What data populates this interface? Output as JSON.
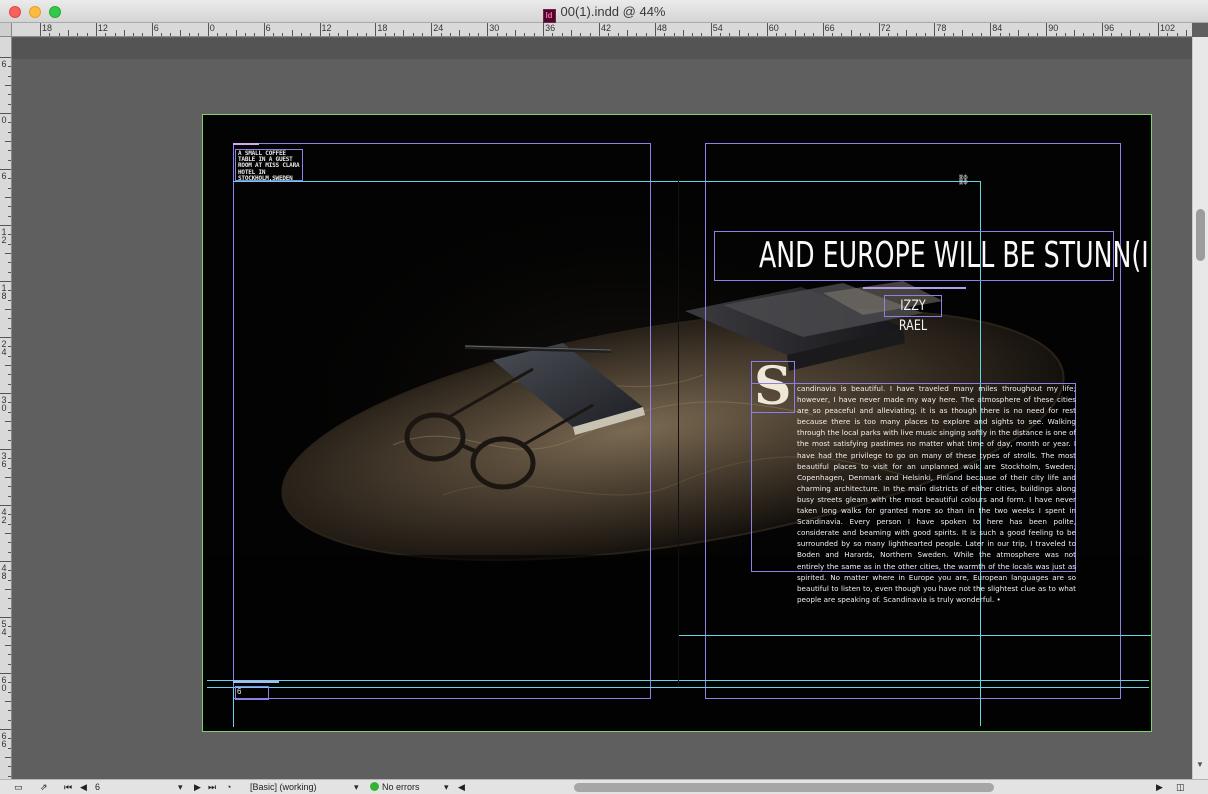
{
  "window": {
    "title": "00(1).indd @ 44%",
    "app_icon": "indesign-doc-icon"
  },
  "rulers": {
    "top_labels": [
      "18",
      "12",
      "6",
      "0",
      "6",
      "12",
      "18",
      "24",
      "30",
      "36",
      "42",
      "48",
      "54",
      "60",
      "66",
      "72",
      "78",
      "84",
      "90",
      "96",
      "102"
    ],
    "left_labels": [
      "6",
      "0",
      "6",
      "12",
      "18",
      "24",
      "30",
      "36",
      "42",
      "48",
      "54",
      "60",
      "66"
    ]
  },
  "spread": {
    "caption": "A SMALL COFFEE TABLE IN A GUEST ROOM AT MISS CLARA HOTEL IN STOCKHOLM,SWEDEN",
    "headline": "AND EUROPE WILL BE STUNN(ING)",
    "byline": "IZZY RAEL",
    "drop_cap": "S",
    "body": "candinavia is beautiful. I have traveled many miles throughout my life; however, I have never made my way here. The atmosphere of these cities are so peaceful and alleviating; it is as though there is no need for rest because there is too many places to explore and sights to see. Walking through the local parks with live music singing softly in the distance is one of the most satisfying pastimes no matter what time of day, month or year. I have had the privilege to go on many of these types of strolls. The most beautiful places to visit for an unplanned walk are Stockholm, Sweden; Copenhagen, Denmark and Helsinki, Finland because of their city life and charming architecture. In the main districts of either cities, buildings along busy streets gleam with the most beautiful colours and form. I have never taken long walks for granted more so than in the two weeks I spent in Scandinavia. Every person I have spoken to here has been polite, considerate and beaming with good spirits. It is such a good feeling to be surrounded by so many lighthearted people. Later in our trip, I traveled to Boden and Harards, Northern Sweden. While the atmosphere was not entirely the same as in the other cities, the warmth of the locals was just as spirited. No matter where in Europe you are, European languages are so beautiful to listen to, even though you have not the slightest clue as to what people are speaking of. Scandinavia is truly wonderful. •",
    "page_number": "6"
  },
  "statusbar": {
    "page_field": "6",
    "preflight_profile": "[Basic] (working)",
    "errors": "No errors"
  },
  "colors": {
    "frame_border": "#8f80e8",
    "guide": "#61d6e6",
    "bleed": "#7dd36a",
    "status_ok": "#34b233"
  }
}
